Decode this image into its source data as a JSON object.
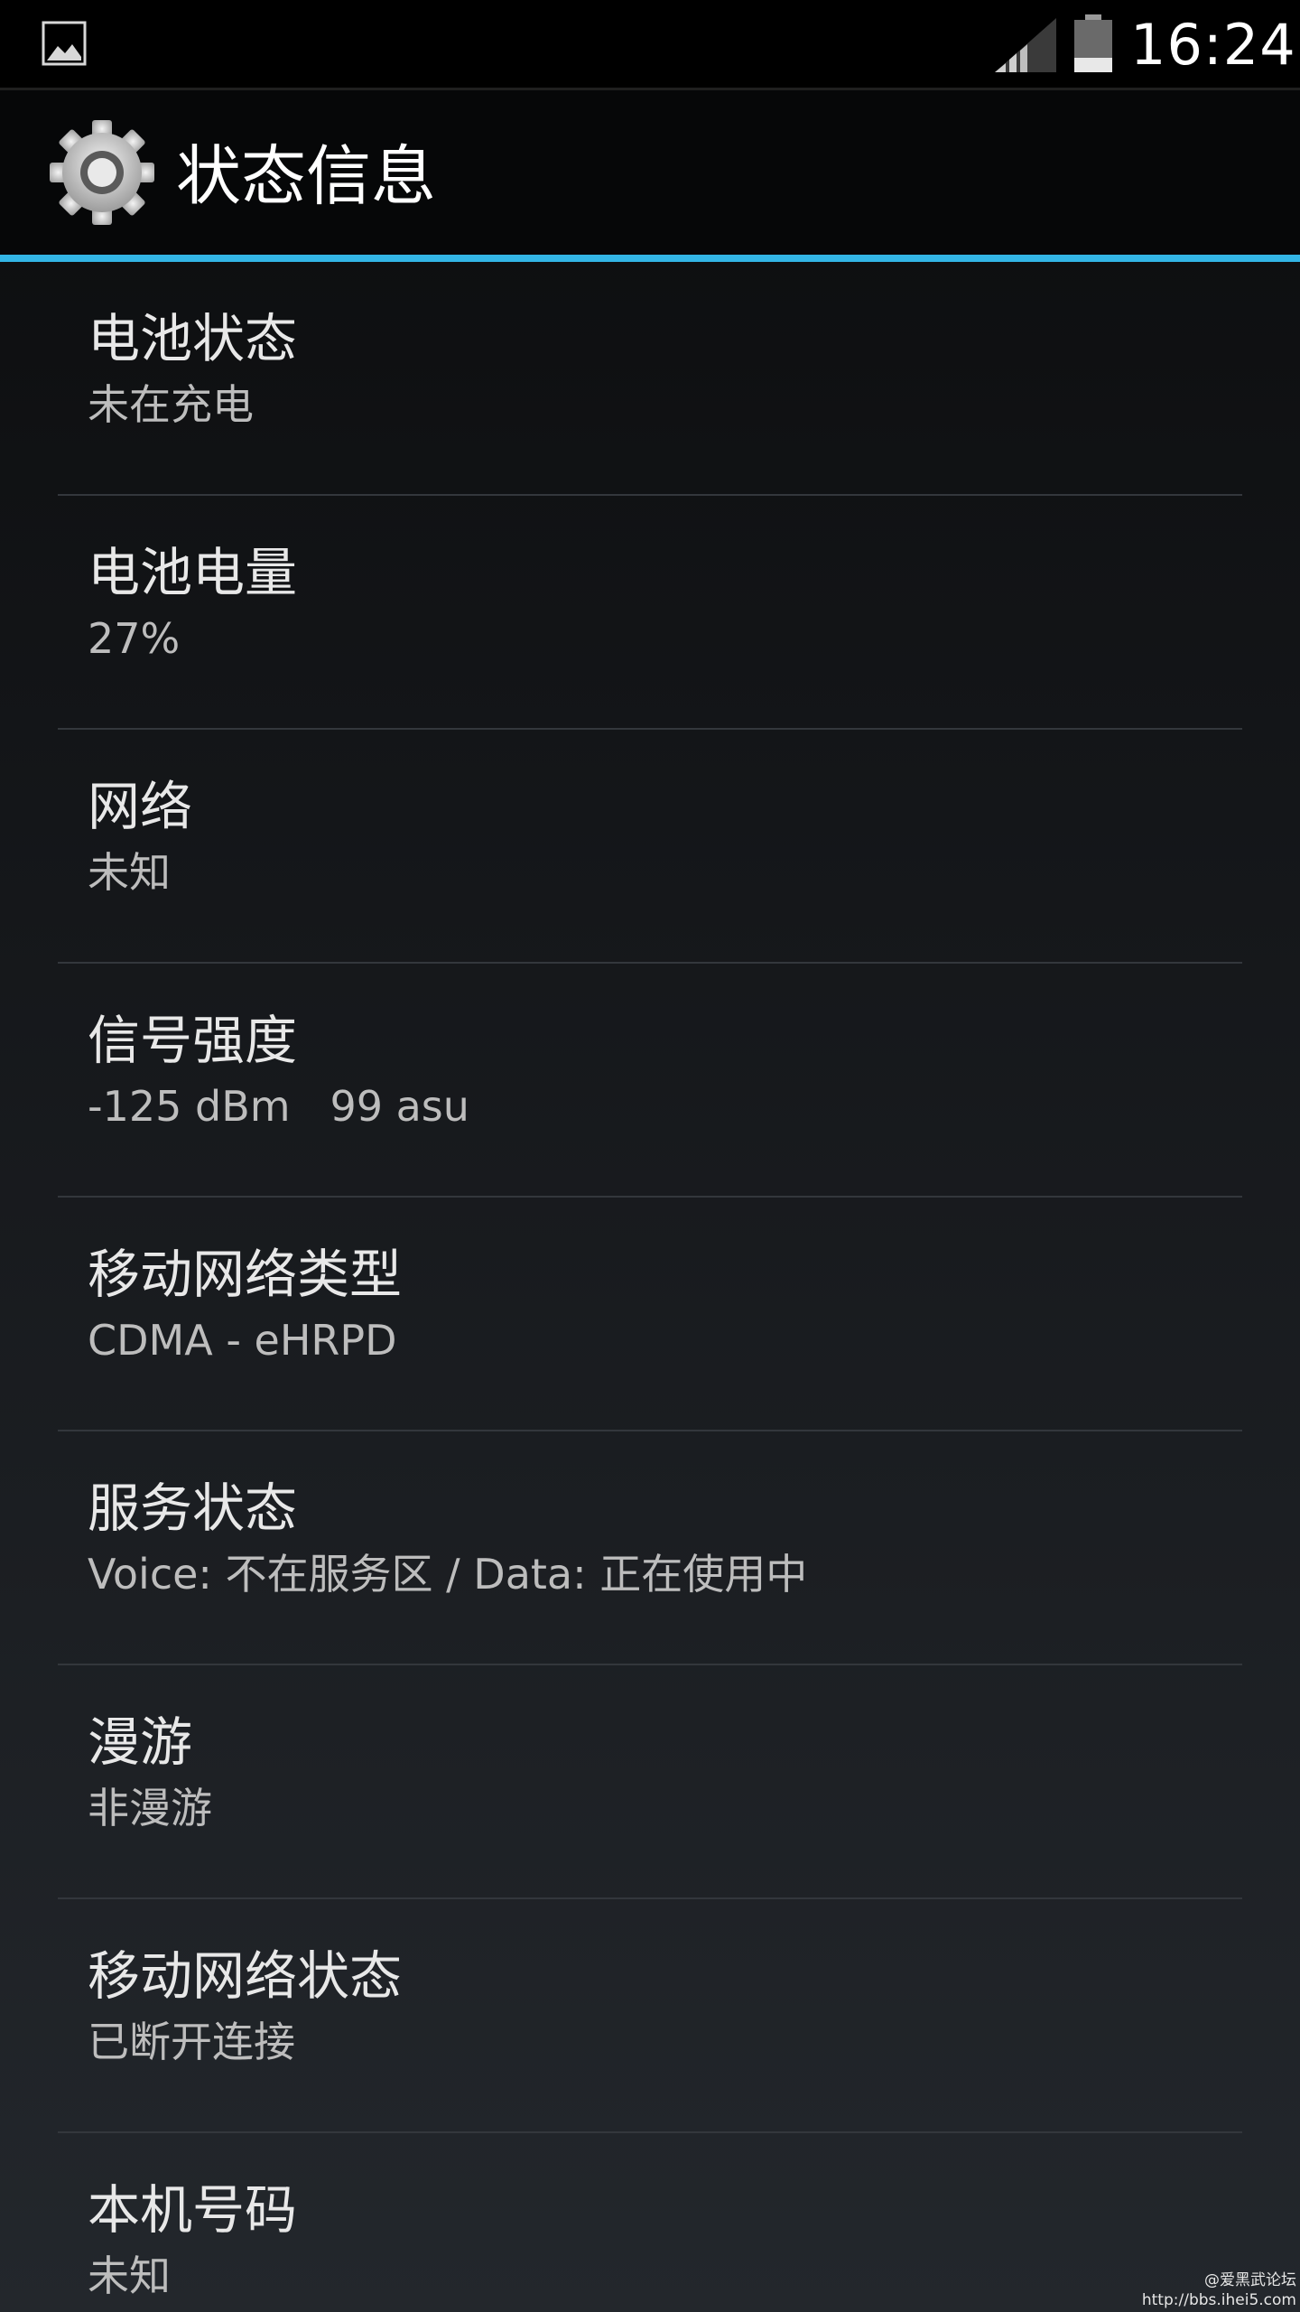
{
  "status_bar": {
    "time": "16:24",
    "icons": [
      "picture-notification-icon",
      "signal-icon",
      "battery-icon"
    ],
    "battery_level_percent": 27
  },
  "action_bar": {
    "title": "状态信息",
    "icon": "settings-gear-icon",
    "accent_color": "#33b5e5"
  },
  "items": [
    {
      "title": "电池状态",
      "summary": "未在充电"
    },
    {
      "title": "电池电量",
      "summary": "27%"
    },
    {
      "title": "网络",
      "summary": "未知"
    },
    {
      "title": "信号强度",
      "summary": "-125 dBm   99 asu"
    },
    {
      "title": "移动网络类型",
      "summary": "CDMA - eHRPD"
    },
    {
      "title": "服务状态",
      "summary": "Voice: 不在服务区 / Data: 正在使用中"
    },
    {
      "title": "漫游",
      "summary": "非漫游"
    },
    {
      "title": "移动网络状态",
      "summary": "已断开连接"
    },
    {
      "title": "本机号码",
      "summary": "未知"
    }
  ],
  "watermark": {
    "line1": "@爱黑武论坛",
    "line2": "http://bbs.ihei5.com"
  }
}
